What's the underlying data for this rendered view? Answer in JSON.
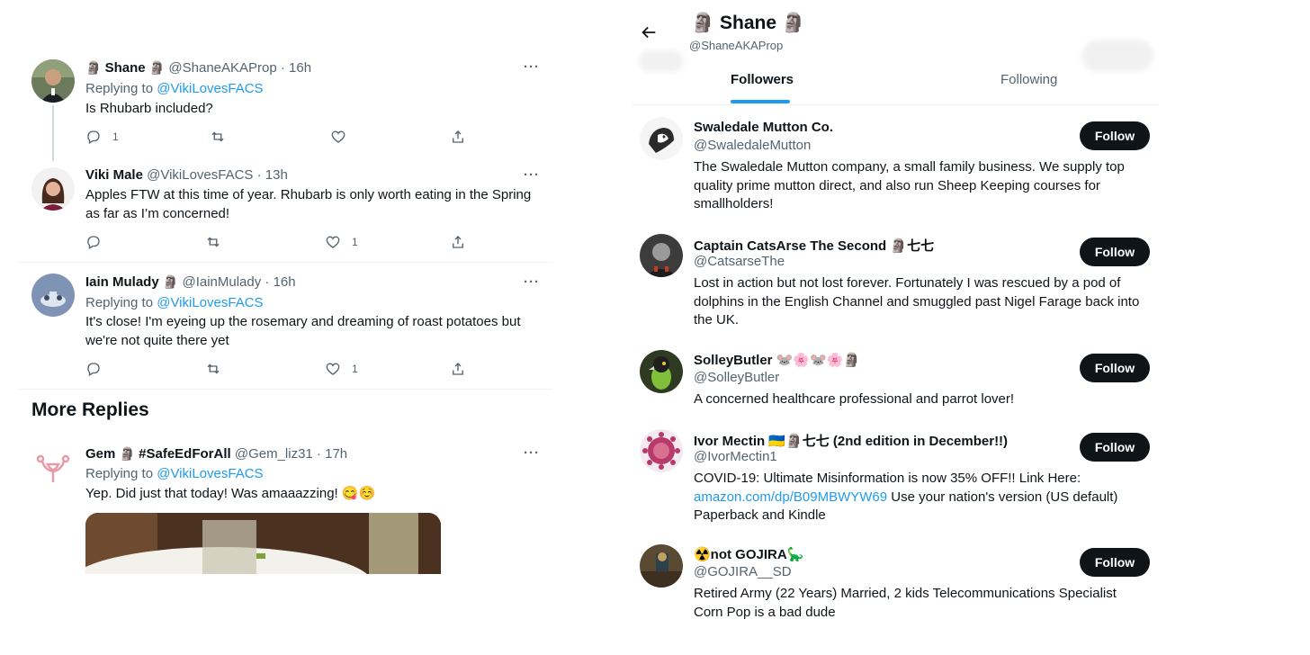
{
  "left": {
    "tweets": [
      {
        "name": "Shane",
        "name_prefix_emoji": "🗿",
        "name_suffix_emoji": "🗿",
        "meta": "@ShaneAKAProp · 16h",
        "replying_label": "Replying to ",
        "replying_to": "@VikiLovesFACS",
        "text": "Is Rhubarb included?",
        "more": "···",
        "reply_count": "1",
        "like_count": ""
      },
      {
        "name": "Viki Male",
        "meta": "@VikiLovesFACS · 13h",
        "text": "Apples FTW at this time of year. Rhubarb is only worth eating in the Spring as far as I’m concerned!",
        "more": "···",
        "reply_count": "",
        "like_count": "1"
      },
      {
        "name": "Iain Mulady",
        "name_suffix_emoji": "🗿",
        "meta": "@IainMulady · 16h",
        "replying_label": "Replying to ",
        "replying_to": "@VikiLovesFACS",
        "text": "It's close! I'm eyeing up the rosemary and dreaming of roast potatoes but we're not quite there yet",
        "more": "···",
        "reply_count": "",
        "like_count": "1"
      }
    ],
    "more_replies_title": "More Replies",
    "reply4": {
      "name": "Gem",
      "name_mid_emoji": "🗿",
      "name_tag": "#SafeEdForAll",
      "meta": "@Gem_liz31 · 17h",
      "replying_label": "Replying to ",
      "replying_to": "@VikiLovesFACS",
      "text": "Yep. Did just that today! Was amaaazzing! 😋☺️",
      "more": "···"
    }
  },
  "right": {
    "header": {
      "title": "Shane",
      "title_prefix_emoji": "🗿",
      "title_suffix_emoji": "🗿",
      "handle": "@ShaneAKAProp"
    },
    "tabs": [
      {
        "label": "Followers",
        "active": true
      },
      {
        "label": "Following",
        "active": false
      }
    ],
    "users": [
      {
        "name": "Swaledale Mutton Co.",
        "handle": "@SwaledaleMutton",
        "bio": "The Swaledale Mutton company, a small family business. We supply top quality prime mutton direct, and also run Sheep Keeping courses for smallholders!",
        "button": "Follow"
      },
      {
        "name": "Captain CatsArse The Second 🗿七七",
        "handle": "@CatsarseThe",
        "bio": "Lost in action but not lost forever. Fortunately I was rescued by a pod of dolphins in the English Channel and smuggled past Nigel Farage back into the UK.",
        "button": "Follow"
      },
      {
        "name": "SolleyButler 🐭🌸🐭🌸🗿",
        "handle": "@SolleyButler",
        "bio": "A concerned healthcare professional and parrot lover!",
        "button": "Follow"
      },
      {
        "name": "Ivor Mectin 🇺🇦🗿七七 (2nd edition in December!!)",
        "handle": "@IvorMectin1",
        "bio_before_link": "COVID-19: Ultimate Misinformation is now 35% OFF!! Link Here: ",
        "bio_link": "amazon.com/dp/B09MBWYW69",
        "bio_after_link": " Use your nation's version (US default) Paperback and Kindle",
        "button": "Follow"
      },
      {
        "name": "☢️not GOJIRA🦕",
        "handle": "@GOJIRA__SD",
        "bio": "Retired Army (22 Years) Married, 2 kids Telecommunications Specialist Corn Pop is a bad dude",
        "button": "Follow"
      }
    ]
  },
  "colors": {
    "text": "#0f1419",
    "secondary": "#536471",
    "link": "#1d9bf0",
    "button_bg": "#0f1419",
    "divider": "#eff3f4"
  }
}
